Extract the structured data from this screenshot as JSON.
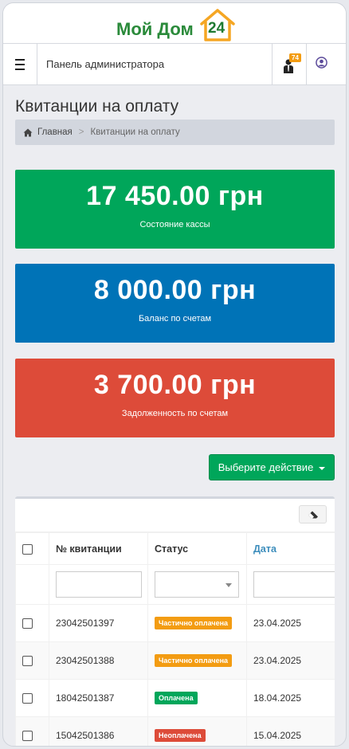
{
  "logo": {
    "text": "Мой Дом",
    "number": "24"
  },
  "topnav": {
    "title": "Панель администратора",
    "notif_count": "74"
  },
  "page": {
    "title": "Квитанции на оплату"
  },
  "breadcrumb": {
    "home": "Главная",
    "separator": ">",
    "current": "Квитанции на оплату"
  },
  "stats": [
    {
      "value": "17 450.00 грн",
      "label": "Состояние кассы",
      "color": "#00a65a"
    },
    {
      "value": "8 000.00 грн",
      "label": "Баланс по счетам",
      "color": "#0073b7"
    },
    {
      "value": "3 700.00 грн",
      "label": "Задолженность по счетам",
      "color": "#dd4b39"
    }
  ],
  "action_button": {
    "label": "Выберите действие"
  },
  "table": {
    "columns": [
      "№ квитанции",
      "Статус",
      "Дата"
    ],
    "rows": [
      {
        "number": "23042501397",
        "status": "Частично оплачена",
        "status_type": "warning",
        "date": "23.04.2025"
      },
      {
        "number": "23042501388",
        "status": "Частично оплачена",
        "status_type": "warning",
        "date": "23.04.2025"
      },
      {
        "number": "18042501387",
        "status": "Оплачена",
        "status_type": "success",
        "date": "18.04.2025"
      },
      {
        "number": "15042501386",
        "status": "Неоплачена",
        "status_type": "danger",
        "date": "15.04.2025"
      }
    ]
  },
  "icons": {
    "menu": "hamburger-icon",
    "notifications": "user-tie-icon",
    "user": "user-circle-icon",
    "home": "home-icon",
    "eraser": "eraser-icon"
  }
}
